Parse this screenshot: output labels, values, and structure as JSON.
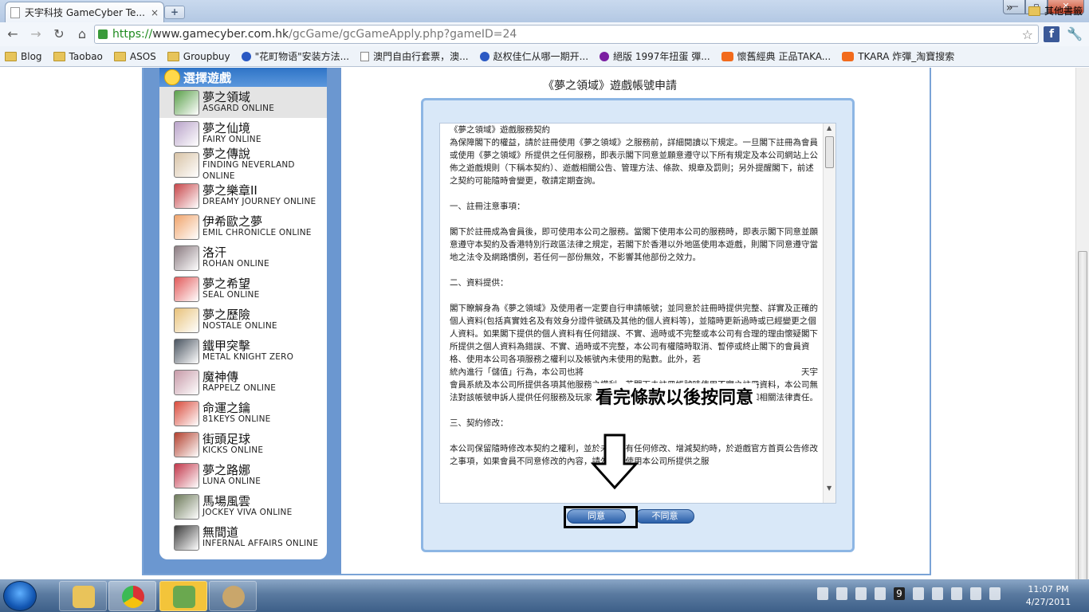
{
  "browser": {
    "tab_title": "天宇科技 GameCyber Te...",
    "tab_close": "×",
    "new_tab": "+",
    "url_scheme": "https://",
    "url_host": "www.gamecyber.com.hk",
    "url_path": "/gcGame/gcGameApply.php?gameID=24",
    "star": "☆",
    "facebook": "f",
    "wrench": "🔧",
    "win_min": "—",
    "win_max": "▫",
    "win_close": "✕"
  },
  "bookmarks": [
    {
      "label": "Blog",
      "icon": "folder"
    },
    {
      "label": "Taobao",
      "icon": "folder"
    },
    {
      "label": "ASOS",
      "icon": "folder"
    },
    {
      "label": "Groupbuy",
      "icon": "folder"
    },
    {
      "label": "\"花町物语\"安装方法...",
      "icon": "paw"
    },
    {
      "label": "澳門自由行套票，澳...",
      "icon": "doc"
    },
    {
      "label": "赵权佳仁从哪一期开...",
      "icon": "paw"
    },
    {
      "label": "絕版 1997年扭蛋 彈...",
      "icon": "yahoo"
    },
    {
      "label": "懷舊經典 正品TAKA...",
      "icon": "tao"
    },
    {
      "label": "TKARA 炸彈_淘寶搜索",
      "icon": "tao"
    }
  ],
  "bookmarks_more": "»",
  "bookmarks_other": "其他書籤",
  "sidebar": {
    "header": "選擇遊戲",
    "games": [
      {
        "zh": "夢之領域",
        "en": "ASGARD ONLINE",
        "color": "#5aa04a",
        "selected": true
      },
      {
        "zh": "夢之仙境",
        "en": "FAIRY ONLINE",
        "color": "#b9a3c9"
      },
      {
        "zh": "夢之傳說",
        "en": "FINDING NEVERLAND ONLINE",
        "color": "#d8c3a6"
      },
      {
        "zh": "夢之樂章II",
        "en": "DREAMY JOURNEY ONLINE",
        "color": "#c7464a"
      },
      {
        "zh": "伊希歐之夢",
        "en": "EMIL CHRONICLE ONLINE",
        "color": "#f0a46b"
      },
      {
        "zh": "洛汗",
        "en": "ROHAN ONLINE",
        "color": "#8a7a80"
      },
      {
        "zh": "夢之希望",
        "en": "SEAL ONLINE",
        "color": "#e25a5a"
      },
      {
        "zh": "夢之歷險",
        "en": "NOSTALE ONLINE",
        "color": "#e8c27a"
      },
      {
        "zh": "鐵甲突擊",
        "en": "METAL KNIGHT ZERO",
        "color": "#4a5460"
      },
      {
        "zh": "魔神傳",
        "en": "RAPPELZ ONLINE",
        "color": "#c79aa8"
      },
      {
        "zh": "命運之鑰",
        "en": "81KEYS ONLINE",
        "color": "#d94b3c"
      },
      {
        "zh": "街頭足球",
        "en": "KICKS ONLINE",
        "color": "#b3402e"
      },
      {
        "zh": "夢之路娜",
        "en": "LUNA ONLINE",
        "color": "#c2364a"
      },
      {
        "zh": "馬場風雲",
        "en": "JOCKEY VIVA ONLINE",
        "color": "#6d7a5a"
      },
      {
        "zh": "無間道",
        "en": "INFERNAL AFFAIRS ONLINE",
        "color": "#3b3b3b"
      }
    ]
  },
  "main": {
    "title": "《夢之領域》遊戲帳號申請",
    "terms": [
      "《夢之領域》遊戲服務契約\n為保障閣下的權益，請於註冊使用《夢之領域》之服務前，詳細閱讀以下規定。一旦閣下註冊為會員或使用《夢之領域》所提供之任何服務，即表示閣下同意並願意遵守以下所有規定及本公司網站上公佈之遊戲規則（下稱本契約）、遊戲相關公告、管理方法、條款、規章及罰則；另外提醒閣下，前述之契約可能隨時會變更，敬請定期查詢。",
      "一、註冊注意事項：",
      "閣下於註冊成為會員後，即可使用本公司之服務。當閣下使用本公司的服務時，即表示閣下同意並願意遵守本契約及香港特別行政區法律之規定，若閣下於香港以外地區使用本遊戲，則閣下同意遵守當地之法令及網路慣例，若任何一部份無效，不影響其他部份之效力。",
      "二、資料提供：",
      "閣下瞭解身為《夢之領域》及使用者一定要自行申請帳號；並同意於註冊時提供完整、詳實及正確的個人資料(包括真實姓名及有效身分證件號碼及其他的個人資料等)，並隨時更新過時或已經變更之個人資料。如果閣下提供的個人資料有任何錯誤、不實、過時或不完整或本公司有合理的理由懷疑閣下所提供之個人資料為錯誤、不實、過時或不完整，本公司有權隨時取消、暫停或終止閣下的會員資格、使用本公司各項服務之權利以及帳號內未使用的點數。此外，若　　　　　　　　　　　　　　　　　　　　　　　　　　統內進行「儲值」行為，本公司也將　　　　　　　　　　　　　　　　　　　　　　　　　　天宇會員系統及本公司所提供各項其他服務之權利。若閣下未註冊帳號時使用不實之註冊資料，本公司無法對該帳號申訴人提供任何服務及玩家權益的保障，該帳號申請人需自負所有損失和相關法律責任。",
      "三、契約修改：",
      "本公司保留隨時修改本契約之權利，並於未來如有任何修改、增減契約時，於遊戲官方首頁公告修改之事項，如果會員不同意修改的內容，請勿繼續使用本公司所提供之服"
    ],
    "agree": "同意",
    "disagree": "不同意",
    "annotation": "看完條款以後按同意"
  },
  "taskbar": {
    "tray_count": "9",
    "time": "11:07 PM",
    "date": "4/27/2011"
  }
}
